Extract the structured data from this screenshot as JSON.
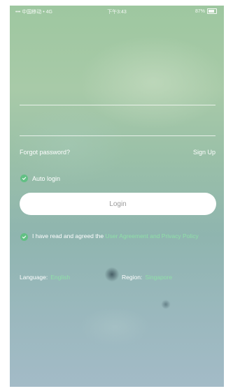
{
  "status_bar": {
    "carrier": "••• 中国移动 • 4G",
    "time": "下午3:43",
    "battery": "87%"
  },
  "form": {
    "forgot_password": "Forgot password?",
    "sign_up": "Sign Up",
    "auto_login": "Auto login",
    "login_button": "Login"
  },
  "agreement": {
    "text": "I have read and agreed the",
    "link": "User Agreement and Privacy Policy"
  },
  "settings": {
    "language_label": "Language:",
    "language_value": "English",
    "region_label": "Region:",
    "region_value": "Singapore"
  },
  "colors": {
    "accent_green": "#62c084",
    "link_green": "#8fe0a8"
  }
}
